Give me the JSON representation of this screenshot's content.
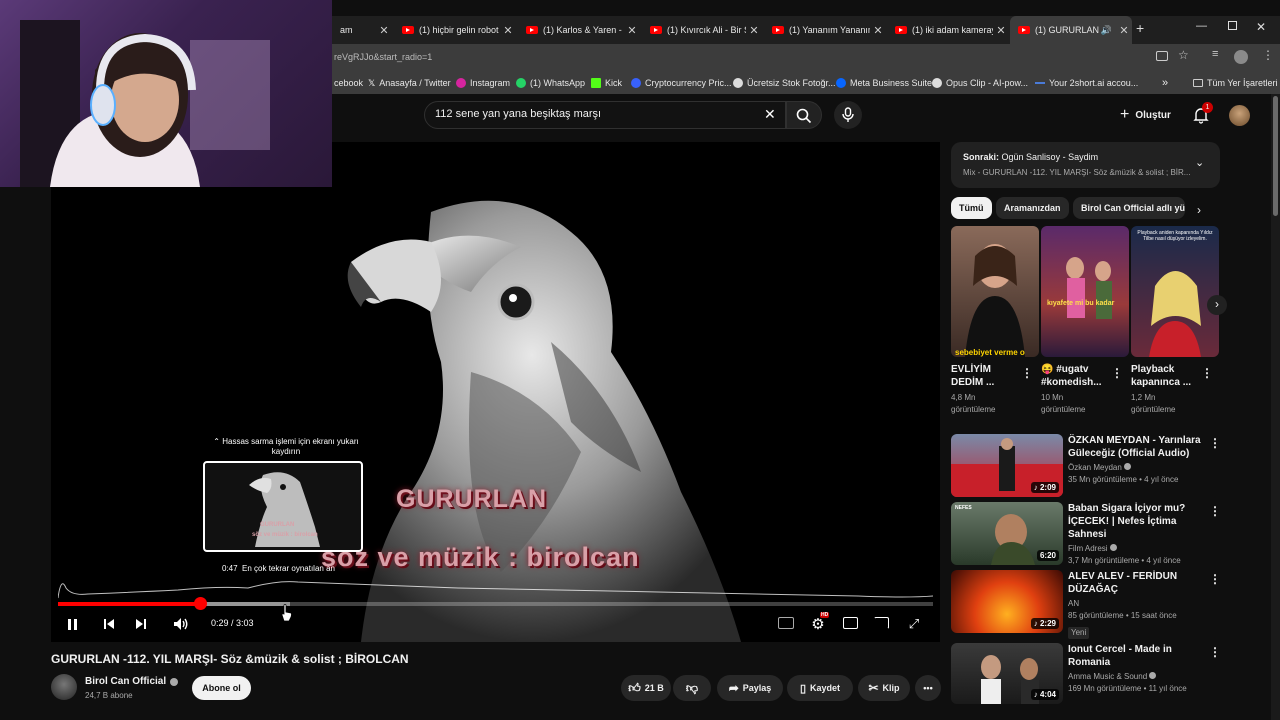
{
  "browser": {
    "tabs": [
      {
        "title": "am",
        "active": false
      },
      {
        "title": "(1) hiçbir gelin robot",
        "active": false
      },
      {
        "title": "(1) Karlos & Yaren - Y",
        "active": false
      },
      {
        "title": "(1) Kıvırcık Ali - Bir Se",
        "active": false
      },
      {
        "title": "(1) Yananım Yananım",
        "active": false
      },
      {
        "title": "(1) iki adam kameray",
        "active": false
      },
      {
        "title": "(1) GURURLAN -",
        "active": true
      }
    ],
    "new_tab": "+",
    "url": "reVgRJJo&start_radio=1",
    "bookmarks": [
      "cebook",
      "Anasayfa / Twitter",
      "Instagram",
      "(1) WhatsApp",
      "Kick",
      "Cryptocurrency Pric...",
      "Ücretsiz Stok Fotoğr...",
      "Meta Business Suite",
      "Opus Clip - AI-pow...",
      "Your 2short.ai accou..."
    ],
    "all_bookmarks": "Tüm Yer İşaretleri"
  },
  "youtube": {
    "search_value": "112 sene yan yana beşiktaş marşı",
    "create_label": "Oluştur",
    "notification_count": "1"
  },
  "player": {
    "overlay_title": "GURURLAN",
    "overlay_sub": "söz ve müzik : birolcan",
    "scrub_hint": "Hassas sarma işlemi için ekranı yukarı kaydırın",
    "hover_time": "0:47",
    "most_replayed": "En çok tekrar oynatılan an",
    "time_display": "0:29 / 3:03",
    "preview_title": "GURURLAN",
    "preview_sub": "söz ve müzik : birolcan",
    "hd_badge": "HD",
    "progress_fraction": 0.162,
    "buffered_fraction": 0.265
  },
  "video": {
    "title": "GURURLAN -112. YIL MARŞI- Söz &müzik & solist ; BİROLCAN",
    "channel": "Birol Can Official",
    "subscribers": "24,7 B abone",
    "subscribe_label": "Abone ol",
    "likes": "21 B",
    "share": "Paylaş",
    "save": "Kaydet",
    "clip": "Klip"
  },
  "sidebar": {
    "next_label": "Sonraki:",
    "next_title": "Ogün Sanlisoy - Saydim",
    "mix_label": "Mix - GURURLAN -112. YIL MARŞI- Söz &müzik & solist ; BİR...",
    "chips": [
      "Tümü",
      "Aramanızdan",
      "Birol Can Official adlı yü"
    ],
    "shorts": [
      {
        "title": "EVLİYİM DEDİM ...",
        "views": "4,8 Mn",
        "views_label": "görüntüleme",
        "thumb_text": "sebebiyet verme o"
      },
      {
        "title": "😝 #ugatv #komedish...",
        "views": "10 Mn",
        "views_label": "görüntüleme",
        "thumb_text": "kıyafete mi bu kadar"
      },
      {
        "title": "Playback kapanınca ...",
        "views": "1,2 Mn",
        "views_label": "görüntüleme",
        "thumb_text": "Playback aniden kapanında Yıldız Tilbe nasıl düşüyor izleyelim."
      }
    ],
    "videos": [
      {
        "title": "ÖZKAN MEYDAN - Yarınlara Güleceğiz (Official Audio)",
        "channel": "Özkan Meydan",
        "verified": true,
        "meta": "35 Mn görüntüleme • 4 yıl önce",
        "duration": "2:09",
        "badge": ""
      },
      {
        "title": "Baban Sigara İçiyor mu? İÇECEK! | Nefes İçtima Sahnesi",
        "channel": "Film Adresi",
        "verified": true,
        "meta": "3,7 Mn görüntüleme • 4 yıl önce",
        "duration": "6:20",
        "badge": "",
        "thumb_label": "NEFES"
      },
      {
        "title": "ALEV ALEV - FERİDUN DÜZAĞAÇ",
        "channel": "AN",
        "verified": false,
        "meta": "85 görüntüleme • 15 saat önce",
        "duration": "2:29",
        "badge": "Yeni"
      },
      {
        "title": "Ionut Cercel - Made in Romania",
        "channel": "Amma Music & Sound",
        "verified": true,
        "meta": "169 Mn görüntüleme • 11 yıl önce",
        "duration": "4:04",
        "badge": ""
      }
    ]
  },
  "colors": {
    "accent": "#ff0000",
    "bg": "#0f0f0f",
    "chip": "#272727"
  }
}
